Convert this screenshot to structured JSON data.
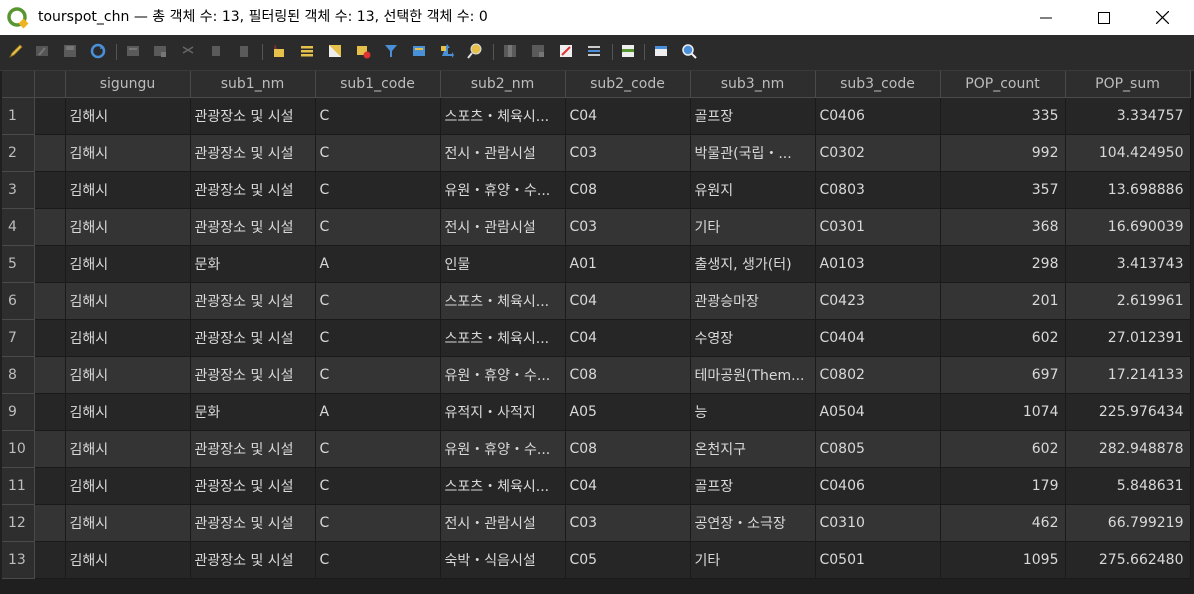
{
  "window": {
    "title": "tourspot_chn — 총 객체 수: 13, 필터링된 객체 수: 13, 선택한 객체 수: 0"
  },
  "toolbar": {
    "icons": [
      "toggle-editing-icon",
      "multi-edit-icon",
      "save-edits-icon",
      "reload-icon",
      "add-feature-icon",
      "delete-feature-icon",
      "cut-icon",
      "copy-icon",
      "paste-icon",
      "select-expression-icon",
      "select-all-icon",
      "invert-selection-icon",
      "deselect-icon",
      "filter-icon",
      "move-selection-top-icon",
      "pan-to-selection-icon",
      "zoom-to-selection-icon",
      "new-field-icon",
      "delete-field-icon",
      "field-calculator-icon",
      "conditional-formatting-icon",
      "dock-table-icon",
      "actions-icon",
      "help-icon"
    ]
  },
  "table": {
    "columns": [
      "sigungu",
      "sub1_nm",
      "sub1_code",
      "sub2_nm",
      "sub2_code",
      "sub3_nm",
      "sub3_code",
      "POP_count",
      "POP_sum"
    ],
    "rows": [
      {
        "n": "1",
        "sigungu": "김해시",
        "sub1_nm": "관광장소 및 시설",
        "sub1_code": "C",
        "sub2_nm": "스포츠・체육시...",
        "sub2_code": "C04",
        "sub3_nm": "골프장",
        "sub3_code": "C0406",
        "POP_count": "335",
        "POP_sum": "3.334757"
      },
      {
        "n": "2",
        "sigungu": "김해시",
        "sub1_nm": "관광장소 및 시설",
        "sub1_code": "C",
        "sub2_nm": "전시・관람시설",
        "sub2_code": "C03",
        "sub3_nm": "박물관(국립・...",
        "sub3_code": "C0302",
        "POP_count": "992",
        "POP_sum": "104.424950"
      },
      {
        "n": "3",
        "sigungu": "김해시",
        "sub1_nm": "관광장소 및 시설",
        "sub1_code": "C",
        "sub2_nm": "유원・휴양・수...",
        "sub2_code": "C08",
        "sub3_nm": "유원지",
        "sub3_code": "C0803",
        "POP_count": "357",
        "POP_sum": "13.698886"
      },
      {
        "n": "4",
        "sigungu": "김해시",
        "sub1_nm": "관광장소 및 시설",
        "sub1_code": "C",
        "sub2_nm": "전시・관람시설",
        "sub2_code": "C03",
        "sub3_nm": "기타",
        "sub3_code": "C0301",
        "POP_count": "368",
        "POP_sum": "16.690039"
      },
      {
        "n": "5",
        "sigungu": "김해시",
        "sub1_nm": "문화",
        "sub1_code": "A",
        "sub2_nm": "인물",
        "sub2_code": "A01",
        "sub3_nm": "출생지, 생가(터)",
        "sub3_code": "A0103",
        "POP_count": "298",
        "POP_sum": "3.413743"
      },
      {
        "n": "6",
        "sigungu": "김해시",
        "sub1_nm": "관광장소 및 시설",
        "sub1_code": "C",
        "sub2_nm": "스포츠・체육시...",
        "sub2_code": "C04",
        "sub3_nm": "관광승마장",
        "sub3_code": "C0423",
        "POP_count": "201",
        "POP_sum": "2.619961"
      },
      {
        "n": "7",
        "sigungu": "김해시",
        "sub1_nm": "관광장소 및 시설",
        "sub1_code": "C",
        "sub2_nm": "스포츠・체육시...",
        "sub2_code": "C04",
        "sub3_nm": "수영장",
        "sub3_code": "C0404",
        "POP_count": "602",
        "POP_sum": "27.012391"
      },
      {
        "n": "8",
        "sigungu": "김해시",
        "sub1_nm": "관광장소 및 시설",
        "sub1_code": "C",
        "sub2_nm": "유원・휴양・수...",
        "sub2_code": "C08",
        "sub3_nm": "테마공원(Them...",
        "sub3_code": "C0802",
        "POP_count": "697",
        "POP_sum": "17.214133"
      },
      {
        "n": "9",
        "sigungu": "김해시",
        "sub1_nm": "문화",
        "sub1_code": "A",
        "sub2_nm": "유적지・사적지",
        "sub2_code": "A05",
        "sub3_nm": "능",
        "sub3_code": "A0504",
        "POP_count": "1074",
        "POP_sum": "225.976434"
      },
      {
        "n": "10",
        "sigungu": "김해시",
        "sub1_nm": "관광장소 및 시설",
        "sub1_code": "C",
        "sub2_nm": "유원・휴양・수...",
        "sub2_code": "C08",
        "sub3_nm": "온천지구",
        "sub3_code": "C0805",
        "POP_count": "602",
        "POP_sum": "282.948878"
      },
      {
        "n": "11",
        "sigungu": "김해시",
        "sub1_nm": "관광장소 및 시설",
        "sub1_code": "C",
        "sub2_nm": "스포츠・체육시...",
        "sub2_code": "C04",
        "sub3_nm": "골프장",
        "sub3_code": "C0406",
        "POP_count": "179",
        "POP_sum": "5.848631"
      },
      {
        "n": "12",
        "sigungu": "김해시",
        "sub1_nm": "관광장소 및 시설",
        "sub1_code": "C",
        "sub2_nm": "전시・관람시설",
        "sub2_code": "C03",
        "sub3_nm": "공연장・소극장",
        "sub3_code": "C0310",
        "POP_count": "462",
        "POP_sum": "66.799219"
      },
      {
        "n": "13",
        "sigungu": "김해시",
        "sub1_nm": "관광장소 및 시설",
        "sub1_code": "C",
        "sub2_nm": "숙박・식음시설",
        "sub2_code": "C05",
        "sub3_nm": "기타",
        "sub3_code": "C0501",
        "POP_count": "1095",
        "POP_sum": "275.662480"
      }
    ]
  }
}
